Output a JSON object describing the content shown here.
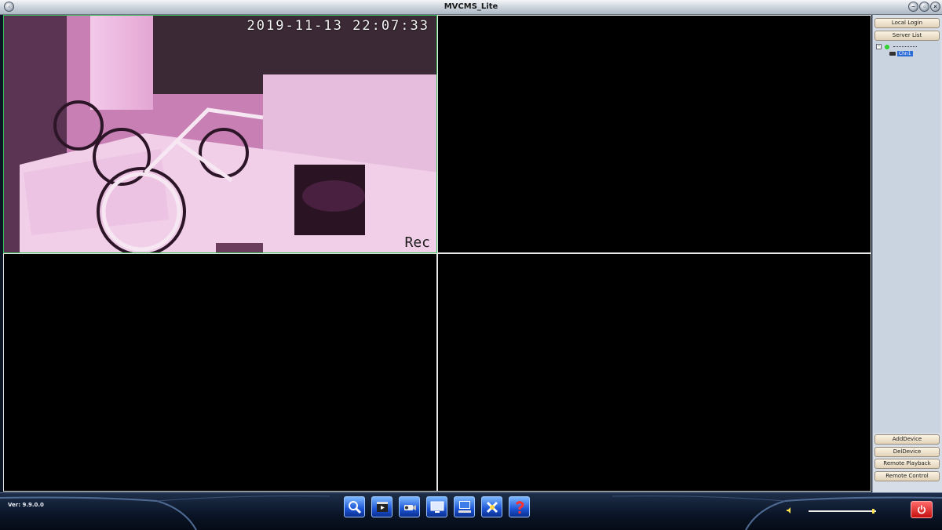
{
  "window": {
    "title": "MVCMS_Lite"
  },
  "video": {
    "panes": [
      {
        "timestamp": "2019-11-13 22:07:33",
        "rec_label": "Rec",
        "active": true
      },
      {
        "active": false
      },
      {
        "active": false
      },
      {
        "active": false
      }
    ]
  },
  "right_panel": {
    "top_buttons": [
      "Local Login",
      "Server List"
    ],
    "device_tree": {
      "channel_label": "Chn1",
      "status_color": "#2ed12e"
    },
    "bottom_buttons": [
      "AddDevice",
      "DelDevice",
      "Remote Playback",
      "Remote Control"
    ]
  },
  "bottom_bar": {
    "version": "Ver: 9.9.0.0",
    "toolbar_icons": [
      "search-icon",
      "playback-icon",
      "camera-icon",
      "monitor-icon",
      "computer-icon",
      "settings-icon",
      "help-icon"
    ],
    "volume_level": 0.97
  },
  "colors": {
    "active_pane_border": "#3cc35a",
    "selection": "#2a6bd6",
    "power": "#c80f0f"
  }
}
